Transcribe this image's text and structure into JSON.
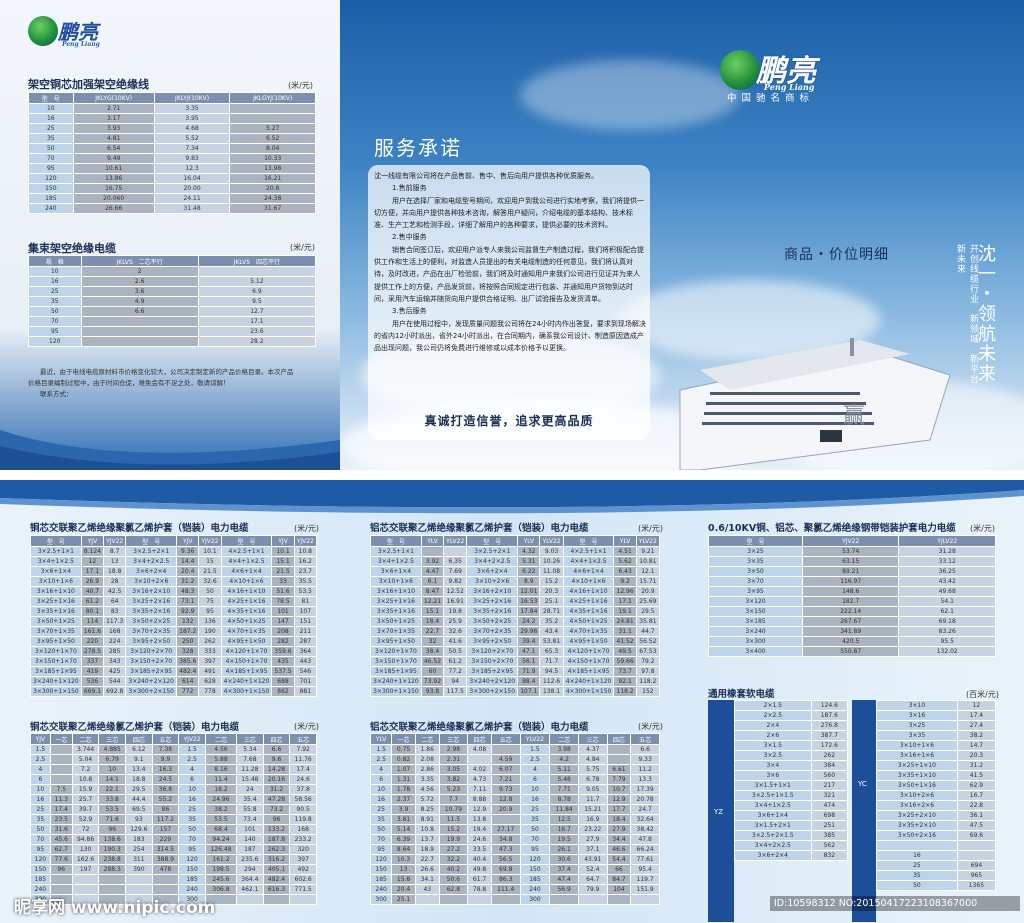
{
  "brand": {
    "name": "鹏亮",
    "latin": "Peng Liang",
    "tagline": "中国驰名商标"
  },
  "t1": {
    "title": "架空铜芯加强架空绝缘线",
    "unit": "(米/元)",
    "head": [
      "型　号",
      "JKLYG(10KV)",
      "JKLYJ(10KV)",
      "JKLGYJ(10KV)"
    ],
    "rows": [
      [
        "10",
        "2.71",
        "3.35",
        ""
      ],
      [
        "16",
        "3.17",
        "3.95",
        ""
      ],
      [
        "25",
        "3.93",
        "4.68",
        "5.27"
      ],
      [
        "35",
        "4.81",
        "5.52",
        "6.52"
      ],
      [
        "50",
        "6.54",
        "7.34",
        "8.04"
      ],
      [
        "70",
        "9.49",
        "9.83",
        "10.33"
      ],
      [
        "95",
        "10.61",
        "12.3",
        "13.98"
      ],
      [
        "120",
        "13.86",
        "16.04",
        "16.21"
      ],
      [
        "150",
        "16.75",
        "20.00",
        "20.8"
      ],
      [
        "185",
        "20.060",
        "24.11",
        "24.38"
      ],
      [
        "240",
        "26.66",
        "31.48",
        "31.67"
      ]
    ]
  },
  "t2": {
    "title": "集束架空绝缘电缆",
    "unit": "(米/元)",
    "head": [
      "规　格",
      "JKLVS　二芯平行",
      "JKLVS　四芯平行"
    ],
    "rows": [
      [
        "10",
        "2",
        ""
      ],
      [
        "16",
        "2.6",
        "5.12"
      ],
      [
        "25",
        "3.6",
        "6.9"
      ],
      [
        "35",
        "4.9",
        "9.5"
      ],
      [
        "50",
        "6.6",
        "12.7"
      ],
      [
        "70",
        "",
        "17.1"
      ],
      [
        "95",
        "",
        "23.6"
      ],
      [
        "120",
        "",
        "28.2"
      ]
    ]
  },
  "notes": [
    "最近，由于电线电缆原材料市价格变化较大，公司决定制定新的产品价格目录。本次产品",
    "价格目录编制过程中，由于时间仓促，难免会有不足之处，敬请谅解！",
    "联系方式："
  ],
  "promise": {
    "title": "服务承诺",
    "paras": [
      "沈一线缆有限公司将在产品售前、售中、售后向用户提供各种优质服务。",
      "1.售前服务",
      "用户在选择厂家和电缆型号期间，欢迎用户到我公司进行实地考察，我们将提供一切方便，并向用户提供各种技术咨询，解答用户疑问，介绍电缆的基本结构、技术标准、生产工艺和检测手段，详细了解用户的各种要求，提供必要的技术资料。",
      "2.售中服务",
      "销售合同签订后，欢迎用户派专人来我公司监督生产制造过程，我们将积极配合提供工作和生活上的便利，对监造人员提出的有关电缆制造的任何意见，我们将认真对待，及时改进，产品在出厂检验前，我们将及时通知用户来我们公司进行见证并为来人提供工作上的方便，产品发货前，将按照合同规定进行包装、并通知用户货物到达时间，采用汽车运输并随货向用户提供合格证明、出厂试验报告及发货清单。",
      "3.售后服务",
      "用户在使用过程中，发现质量问题我公司将在24小时内作出答复，要求到现场解决的省内12小时派出，省外24小时派出，在合同期内，确系我公司设计、制造原因造成产品出现问题，我公司仍将免费进行维修或以成本价格予以更换。"
    ],
    "slogan": "真诚打造信誉，追求更高品质"
  },
  "price_title": "商品・价位明细",
  "vertical_big": "沈一・领航未来",
  "vertical_small": "开创线缆行业　新领域　新平台　新未来",
  "ship_char": "赢",
  "b1": {
    "title": "铜芯交联聚乙烯绝缘聚氯乙烯护套（铠装）电力电缆",
    "unit": "(米/元)",
    "head": [
      "型　号",
      "YJV",
      "YJV22",
      "型　号",
      "YJV",
      "YJV22",
      "型　号",
      "YJV",
      "YJV22"
    ],
    "rows": [
      [
        "3×2.5+1×1",
        "8.124",
        "8.7",
        "3×2.5+2×1",
        "9.36",
        "10.1",
        "4×2.5+1×1",
        "10.1",
        "10.8"
      ],
      [
        "3×4+1×2.5",
        "12",
        "13",
        "3×4+2×2.5",
        "14.4",
        "15",
        "4×4+1×2.5",
        "15.1",
        "16.2"
      ],
      [
        "3×6+1×4",
        "17.1",
        "18.8",
        "3×6+2×4",
        "20.4",
        "21.5",
        "4×6+1×4",
        "21.5",
        "23.7"
      ],
      [
        "3×10+1×6",
        "26.9",
        "28",
        "3×10+2×6",
        "31.2",
        "32.6",
        "4×10+1×6",
        "33",
        "35.5"
      ],
      [
        "3×16+1×10",
        "40.7",
        "42.5",
        "3×16+2×10",
        "48.3",
        "50",
        "4×16+1×10",
        "51.6",
        "53.5"
      ],
      [
        "3×25+1×16",
        "61.2",
        "64",
        "3×25+2×16",
        "73.1",
        "75",
        "4×25+1×16",
        "78.5",
        "81"
      ],
      [
        "3×35+1×16",
        "80.1",
        "83",
        "3×35+2×16",
        "92.9",
        "95",
        "4×35+1×16",
        "101",
        "107"
      ],
      [
        "3×50+1×25",
        "114",
        "117.3",
        "3×50+2×25",
        "132",
        "136",
        "4×50+1×25",
        "147",
        "151"
      ],
      [
        "3×70+1×35",
        "161.6",
        "168",
        "3×70+2×35",
        "187.2",
        "190",
        "4×70+1×35",
        "208",
        "211"
      ],
      [
        "3×95+1×50",
        "220",
        "224",
        "3×95+2×50",
        "250",
        "262",
        "4×95+1×50",
        "282",
        "287"
      ],
      [
        "3×120+1×70",
        "278.5",
        "285",
        "3×120+2×70",
        "328",
        "333",
        "4×120+1×70",
        "359.6",
        "364"
      ],
      [
        "3×150+1×70",
        "337",
        "343",
        "3×150+2×70",
        "385.6",
        "397",
        "4×150+1×70",
        "435",
        "443"
      ],
      [
        "3×185+1×95",
        "419",
        "425",
        "3×185+2×95",
        "482.4",
        "491",
        "4×185+1×95",
        "537.5",
        "546"
      ],
      [
        "3×240+1×120",
        "536",
        "544",
        "3×240+2×120",
        "614",
        "628",
        "4×240+1×120",
        "688",
        "701"
      ],
      [
        "3×300+1×150",
        "669.1",
        "692.8",
        "3×300+2×150",
        "772",
        "778",
        "4×300+1×150",
        "862",
        "881"
      ]
    ]
  },
  "b2": {
    "title": "铝芯交联聚乙烯绝缘聚氯乙烯护套（铠装）电力电缆",
    "unit": "(米/元)",
    "head": [
      "型　号",
      "YLV",
      "YLV22",
      "型　号",
      "YLV",
      "YLV22",
      "型　号",
      "YLV",
      "YLV22"
    ],
    "rows": [
      [
        "3×2.5+1×1",
        "",
        "",
        "3×2.5+2×1",
        "4.32",
        "9.03",
        "4×2.5+1×1",
        "4.51",
        "9.21"
      ],
      [
        "3×4+1×2.5",
        "3.92",
        "6.35",
        "3×4+2×2.5",
        "5.31",
        "10.26",
        "4×4+1×2.5",
        "5.62",
        "10.81"
      ],
      [
        "3×6+1×4",
        "4.47",
        "7.69",
        "3×6+2×4",
        "6.22",
        "11.08",
        "4×6+1×4",
        "6.43",
        "12.1"
      ],
      [
        "3×10+1×6",
        "6.1",
        "9.82",
        "3×10+2×6",
        "8.9",
        "15.2",
        "4×10+1×6",
        "9.2",
        "15.71"
      ],
      [
        "3×16+1×10",
        "8.47",
        "12.52",
        "3×16+2×10",
        "12.01",
        "20.3",
        "4×16+1×10",
        "12.96",
        "20.9"
      ],
      [
        "3×25+1×16",
        "12.21",
        "16.91",
        "3×25+2×16",
        "16.53",
        "25.1",
        "4×25+1×16",
        "17.1",
        "25.69"
      ],
      [
        "3×35+1×16",
        "15.1",
        "19.8",
        "3×35+2×16",
        "17.84",
        "28.71",
        "4×35+1×16",
        "19.1",
        "29.5"
      ],
      [
        "3×50+1×25",
        "18.4",
        "25.9",
        "3×50+2×25",
        "24.2",
        "35.2",
        "4×50+1×25",
        "24.81",
        "35.81"
      ],
      [
        "3×70+1×35",
        "22.7",
        "32.6",
        "3×70+2×35",
        "29.96",
        "43.4",
        "4×70+1×35",
        "31.1",
        "44.7"
      ],
      [
        "3×95+1×50",
        "32",
        "41.6",
        "3×95+2×50",
        "39.4",
        "53.81",
        "4×95+1×50",
        "41.52",
        "56.52"
      ],
      [
        "3×120+1×70",
        "38.4",
        "50.5",
        "3×120+2×70",
        "47.1",
        "65.3",
        "4×120+1×70",
        "49.5",
        "67.53"
      ],
      [
        "3×150+1×70",
        "46.52",
        "61.2",
        "3×150+2×70",
        "56.1",
        "71.7",
        "4×150+1×70",
        "59.66",
        "79.2"
      ],
      [
        "3×185+1×95",
        "60",
        "77.2",
        "3×185+2×95",
        "71.9",
        "94.5",
        "4×185+1×95",
        "73.7",
        "97.8"
      ],
      [
        "3×240+1×120",
        "73.92",
        "94",
        "3×240+2×120",
        "88.4",
        "112.6",
        "4×240+1×120",
        "92.1",
        "118.2"
      ],
      [
        "3×300+1×150",
        "93.8",
        "117.5",
        "3×300+2×150",
        "107.1",
        "138.1",
        "4×300+1×150",
        "118.2",
        "152"
      ]
    ]
  },
  "b3": {
    "title": "0.6/10KV铜、铝芯、聚氯乙烯绝缘钢带铠装护套电力电缆",
    "unit": "(米/元)",
    "head": [
      "型　号",
      "YJV22",
      "YJLV22"
    ],
    "rows": [
      [
        "3×25",
        "53.74",
        "31.28"
      ],
      [
        "3×35",
        "63.15",
        "33.12"
      ],
      [
        "3×50",
        "89.21",
        "36.25"
      ],
      [
        "3×70",
        "116.97",
        "43.42"
      ],
      [
        "3×95",
        "148.6",
        "49.68"
      ],
      [
        "3×120",
        "182.7",
        "54.1"
      ],
      [
        "3×150",
        "222.14",
        "62.1"
      ],
      [
        "3×185",
        "267.67",
        "69.18"
      ],
      [
        "3×240",
        "341.89",
        "83.26"
      ],
      [
        "3×300",
        "420.5",
        "95.5"
      ],
      [
        "3×400",
        "550.87",
        "132.02"
      ]
    ]
  },
  "b4": {
    "title": "铜芯交联聚乙烯绝缘氯乙烯护套（铠装）电力电缆",
    "unit": "(米/元)",
    "head": [
      "YJV",
      "一芯",
      "二芯",
      "三芯",
      "四芯",
      "五芯",
      "YJV22",
      "二芯",
      "三芯",
      "四芯",
      "五芯"
    ],
    "rows": [
      [
        "1.5",
        "",
        "3.744",
        "4.885",
        "6.12",
        "7.38",
        "1.5",
        "4.56",
        "5.34",
        "6.6",
        "7.92"
      ],
      [
        "2.5",
        "",
        "5.04",
        "6.79",
        "9.1",
        "9.9",
        "2.5",
        "5.88",
        "7.68",
        "9.6",
        "11.76"
      ],
      [
        "4",
        "",
        "7.2",
        "10",
        "13.4",
        "16.3",
        "4",
        "8.16",
        "11.28",
        "14.28",
        "17.4"
      ],
      [
        "6",
        "",
        "10.8",
        "14.1",
        "18.8",
        "24.5",
        "6",
        "11.4",
        "15.48",
        "20.16",
        "24.6"
      ],
      [
        "10",
        "7.5",
        "15.9",
        "22.1",
        "29.5",
        "36.8",
        "10",
        "18.2",
        "24",
        "31.2",
        "37.8"
      ],
      [
        "16",
        "11.3",
        "25.7",
        "33.8",
        "44.4",
        "55.2",
        "16",
        "24.96",
        "35.4",
        "47.28",
        "58.56"
      ],
      [
        "25",
        "17.4",
        "39.7",
        "53.5",
        "69.5",
        "86",
        "25",
        "38.2",
        "55.8",
        "73.2",
        "90.5"
      ],
      [
        "35",
        "23.5",
        "52.9",
        "71.6",
        "93",
        "117.2",
        "35",
        "53.5",
        "73.4",
        "96",
        "119.8"
      ],
      [
        "50",
        "31.6",
        "72",
        "96",
        "129.6",
        "157",
        "50",
        "68.4",
        "101",
        "133.2",
        "168"
      ],
      [
        "70",
        "45.6",
        "94.86",
        "138.6",
        "183",
        "229",
        "70",
        "94.24",
        "140",
        "187.8",
        "233.2"
      ],
      [
        "95",
        "62.7",
        "130",
        "190.3",
        "254",
        "314.5",
        "95",
        "126.48",
        "187",
        "262.3",
        "320"
      ],
      [
        "120",
        "77.6",
        "162.6",
        "238.8",
        "311",
        "388.9",
        "120",
        "161.2",
        "235.6",
        "316.2",
        "397"
      ],
      [
        "150",
        "96",
        "197",
        "288.3",
        "390",
        "478",
        "150",
        "198.5",
        "294",
        "405.1",
        "492"
      ],
      [
        "185",
        "",
        "",
        "",
        "",
        "",
        "185",
        "245.6",
        "364.4",
        "482.4",
        "602.6"
      ],
      [
        "240",
        "",
        "",
        "",
        "",
        "",
        "240",
        "306.8",
        "462.1",
        "616.3",
        "771.5"
      ],
      [
        "300",
        "",
        "",
        "",
        "",
        "",
        "300",
        "",
        "",
        "",
        ""
      ]
    ]
  },
  "b5": {
    "title": "铝芯交联聚乙烯绝缘聚氯乙烯护套（铠装）电力电缆",
    "unit": "(米/元)",
    "head": [
      "YLV",
      "一芯",
      "二芯",
      "三芯",
      "四芯",
      "五芯",
      "YLV22",
      "二芯",
      "三芯",
      "四芯",
      "五芯"
    ],
    "rows": [
      [
        "1.5",
        "0.75",
        "1.86",
        "2.98",
        "4.08",
        "",
        "1.5",
        "3.98",
        "4.37",
        "",
        "6.6"
      ],
      [
        "2.5",
        "0.82",
        "2.08",
        "2.31",
        "",
        "4.59",
        "2.5",
        "4.2",
        "4.84",
        "",
        "9.33"
      ],
      [
        "4",
        "1.07",
        "2.86",
        "3.05",
        "4.02",
        "6.07",
        "4",
        "5.11",
        "5.75",
        "6.61",
        "11.2"
      ],
      [
        "6",
        "1.31",
        "3.35",
        "3.82",
        "4.73",
        "7.21",
        "6",
        "5.48",
        "6.78",
        "7.79",
        "13.3"
      ],
      [
        "10",
        "1.78",
        "4.56",
        "5.23",
        "7.11",
        "9.73",
        "10",
        "7.71",
        "9.05",
        "10.7",
        "17.39"
      ],
      [
        "16",
        "2.37",
        "5.72",
        "7.7",
        "8.88",
        "12.8",
        "16",
        "8.78",
        "11.7",
        "12.9",
        "20.78"
      ],
      [
        "25",
        "3.9",
        "8.25",
        "10.79",
        "12.9",
        "20.9",
        "25",
        "11.84",
        "15.21",
        "17.7",
        "24.7"
      ],
      [
        "35",
        "3.81",
        "8.91",
        "11.5",
        "13.8",
        "",
        "35",
        "12.5",
        "16.9",
        "18.4",
        "32.64"
      ],
      [
        "50",
        "5.14",
        "10.8",
        "15.2",
        "19.4",
        "27.17",
        "50",
        "16.7",
        "23.22",
        "27.9",
        "38.42"
      ],
      [
        "70",
        "6.39",
        "13.7",
        "19.9",
        "24.6",
        "34.8",
        "70",
        "19.5",
        "27.9",
        "34.4",
        "47.8"
      ],
      [
        "95",
        "8.64",
        "18.9",
        "27.2",
        "33.5",
        "47.3",
        "95",
        "26.1",
        "37.1",
        "46.6",
        "66.24"
      ],
      [
        "120",
        "10.3",
        "22.7",
        "32.2",
        "40.4",
        "56.5",
        "120",
        "30.6",
        "43.91",
        "54.4",
        "77.61"
      ],
      [
        "150",
        "13",
        "26.6",
        "40.2",
        "49.8",
        "69.8",
        "150",
        "37.4",
        "52.4",
        "66",
        "95.4"
      ],
      [
        "185",
        "15.8",
        "34.1",
        "50.6",
        "61.7",
        "86.3",
        "185",
        "47.4",
        "64.7",
        "84.7",
        "119.7"
      ],
      [
        "240",
        "20.4",
        "43",
        "62.8",
        "78.8",
        "111.4",
        "240",
        "56.9",
        "79.9",
        "104",
        "151.9"
      ],
      [
        "300",
        "25.1",
        "",
        "",
        "",
        "",
        "300",
        "",
        "",
        "",
        ""
      ]
    ]
  },
  "b6": {
    "title": "通用橡套软电缆",
    "unit": "(百米/元)",
    "left_label": "YZ",
    "right_label": "YC",
    "left": [
      [
        "2×1.5",
        "124.6"
      ],
      [
        "2×2.5",
        "187.6"
      ],
      [
        "2×4",
        "276.8"
      ],
      [
        "2×6",
        "387.7"
      ],
      [
        "3×1.5",
        "172.6"
      ],
      [
        "3×2.5",
        "262"
      ],
      [
        "3×4",
        "384"
      ],
      [
        "3×6",
        "560"
      ],
      [
        "3×1.5+1×1",
        "217"
      ],
      [
        "3×2.5+1×1.5",
        "321"
      ],
      [
        "3×4+1×2.5",
        "474"
      ],
      [
        "3×6+1×4",
        "698"
      ],
      [
        "3×1.5+2×1",
        "251"
      ],
      [
        "3×2.5+2×1.5",
        "385"
      ],
      [
        "3×4+2×2.5",
        "562"
      ],
      [
        "3×6+2×4",
        "832"
      ]
    ],
    "right": [
      [
        "3×10",
        "12"
      ],
      [
        "3×16",
        "17.4"
      ],
      [
        "3×25",
        "27.4"
      ],
      [
        "3×35",
        "38.2"
      ],
      [
        "3×10+1×6",
        "14.7"
      ],
      [
        "3×16+1×6",
        "20.3"
      ],
      [
        "3×25+1×10",
        "31.2"
      ],
      [
        "3×35+1×10",
        "41.5"
      ],
      [
        "3×50+1×16",
        "62.9"
      ],
      [
        "3×10+2×6",
        "16.7"
      ],
      [
        "3×16+2×6",
        "22.8"
      ],
      [
        "3×25+2×10",
        "36.1"
      ],
      [
        "3×35+2×10",
        "47.5"
      ],
      [
        "3×50+2×16",
        "69.6"
      ],
      [
        "",
        ""
      ],
      [
        "16",
        ""
      ],
      [
        "25",
        "694"
      ],
      [
        "35",
        "965"
      ],
      [
        "50",
        "1365"
      ]
    ]
  },
  "watermark": {
    "left": "昵享网 www.nipic.com",
    "right": "ID:10598312 NO:20150417223108367000"
  }
}
